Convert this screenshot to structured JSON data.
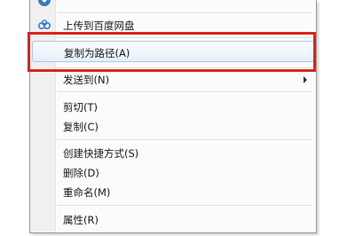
{
  "menu": {
    "items": [
      {
        "label": "",
        "partial": true
      },
      {
        "label": "上传到百度网盘"
      },
      {
        "label": "复制为路径(A)",
        "highlighted": true
      },
      {
        "label": "发送到(N)",
        "has_submenu": true
      },
      {
        "label": "剪切(T)"
      },
      {
        "label": "复制(C)"
      },
      {
        "label": "创建快捷方式(S)"
      },
      {
        "label": "删除(D)"
      },
      {
        "label": "重命名(M)"
      },
      {
        "label": "属性(R)"
      }
    ]
  },
  "colors": {
    "annotation_box": "#d9261c",
    "highlight_border": "#a8c8ea"
  },
  "icons": [
    "partial-app-icon",
    "baidu-cloud-icon",
    "submenu-arrow-icon"
  ]
}
